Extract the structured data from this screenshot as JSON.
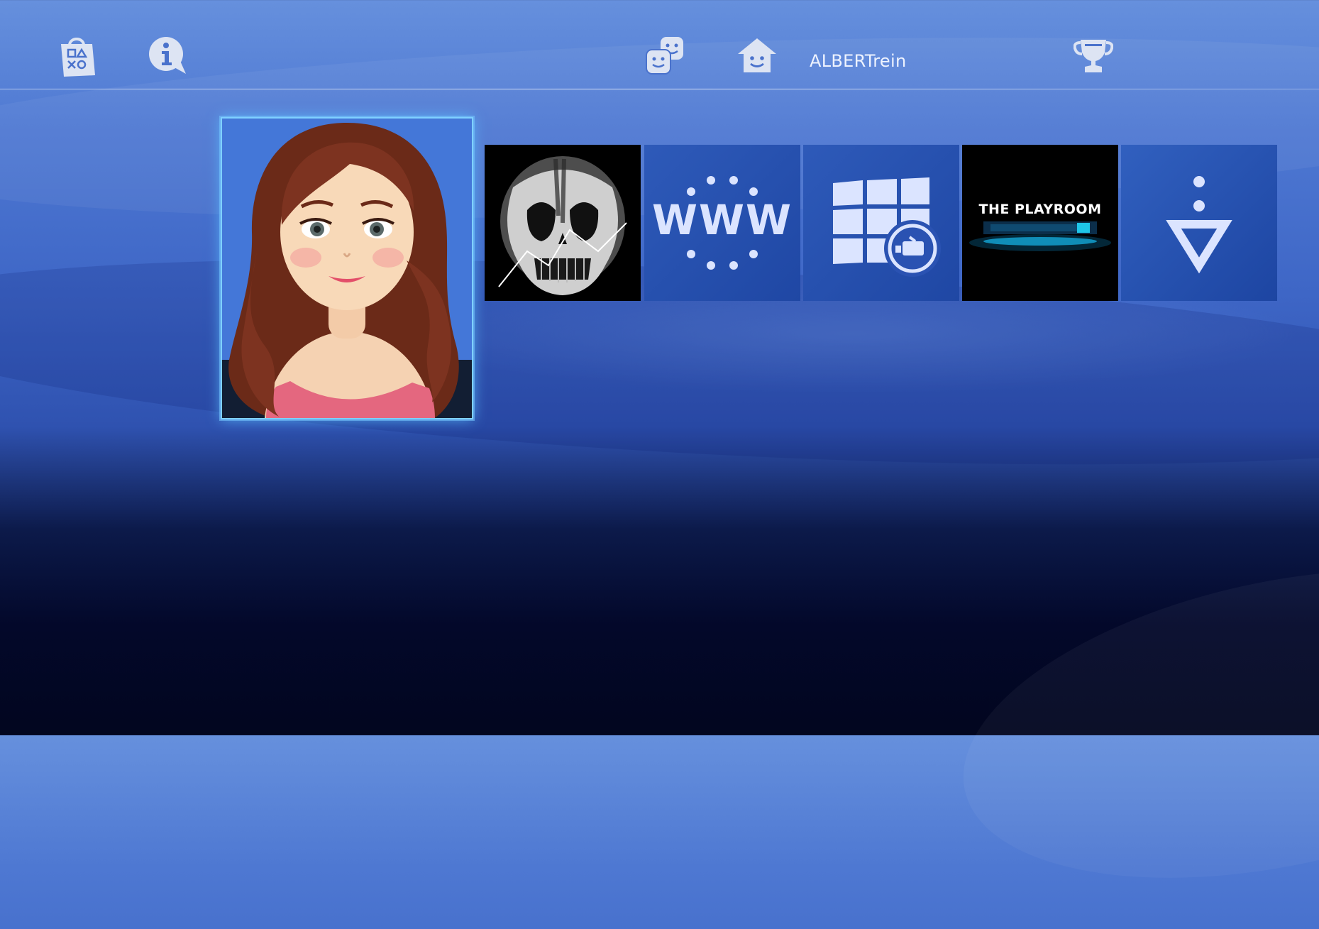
{
  "user": {
    "name": "ALBERTrein"
  },
  "topbar": {
    "icons": [
      "playstation-store-icon",
      "info-icon",
      "friends-icon",
      "home-profile-icon",
      "trophy-icon"
    ]
  },
  "tiles": [
    {
      "id": "profile",
      "kind": "avatar-portrait",
      "selected": true
    },
    {
      "id": "ghosts",
      "kind": "game-art"
    },
    {
      "id": "internet-browser",
      "label": "WWW"
    },
    {
      "id": "tv-video",
      "kind": "tv-icon"
    },
    {
      "id": "the-playroom",
      "label": "THE PLAYROOM"
    },
    {
      "id": "library",
      "kind": "library-icon"
    }
  ],
  "colors": {
    "accent_glow": "#7fd0ff",
    "background_top": "#6690dd",
    "background_bottom": "#02061f",
    "icon_color": "#dde4f3"
  }
}
